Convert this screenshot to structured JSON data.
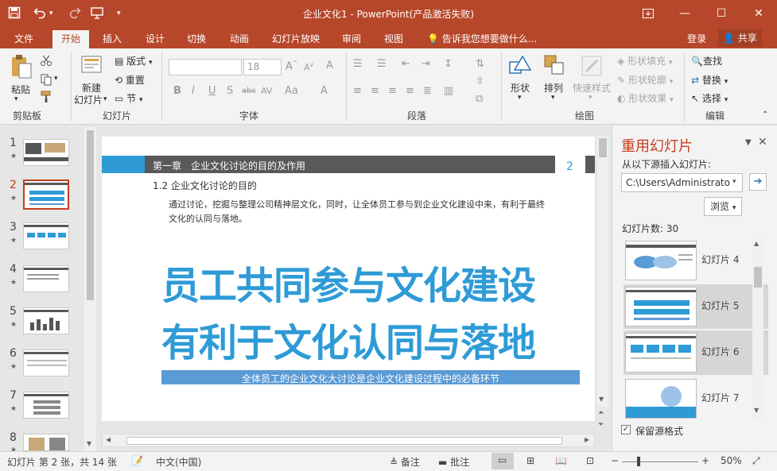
{
  "window": {
    "title": "企业文化1 - PowerPoint(产品激活失败)",
    "minimize_glyph": "—",
    "restore_glyph": "❐",
    "maximize_glyph": "☐",
    "close_glyph": "✕"
  },
  "qat": {
    "save_icon": "save-icon",
    "undo_icon": "undo-icon",
    "redo_icon": "redo-icon",
    "present_icon": "present-icon",
    "more": "▾"
  },
  "tabs": [
    "文件",
    "开始",
    "插入",
    "设计",
    "切换",
    "动画",
    "幻灯片放映",
    "审阅",
    "视图"
  ],
  "active_tab": "开始",
  "tell_me": "告诉我您想要做什么...",
  "account": {
    "login": "登录",
    "share": "共享"
  },
  "ribbon": {
    "clipboard": {
      "label": "剪贴板",
      "paste": "粘贴"
    },
    "slides": {
      "label": "幻灯片",
      "new_slide_line1": "新建",
      "new_slide_line2": "幻灯片",
      "layout": "版式",
      "reset": "重置",
      "section": "节"
    },
    "font": {
      "label": "字体",
      "font_name": "",
      "font_size": "18",
      "bold": "B",
      "italic": "I",
      "underline": "U",
      "strike": "S",
      "shadow": "abc",
      "spacing": "AV",
      "case": "Aa",
      "grow": "A",
      "shrink": "A",
      "clear": "A",
      "color": "A"
    },
    "paragraph": {
      "label": "段落"
    },
    "drawing": {
      "label": "绘图",
      "shapes": "形状",
      "arrange": "排列",
      "quick_styles": "快速样式",
      "fill": "形状填充",
      "outline": "形状轮廓",
      "effects": "形状效果"
    },
    "editing": {
      "label": "编辑",
      "find": "查找",
      "replace": "替换",
      "select": "选择"
    }
  },
  "thumbnails": [
    {
      "num": "1",
      "star": "★",
      "selected": false
    },
    {
      "num": "2",
      "star": "★",
      "selected": true
    },
    {
      "num": "3",
      "star": "★",
      "selected": false
    },
    {
      "num": "4",
      "star": "★",
      "selected": false
    },
    {
      "num": "5",
      "star": "★",
      "selected": false
    },
    {
      "num": "6",
      "star": "★",
      "selected": false
    },
    {
      "num": "7",
      "star": "★",
      "selected": false
    },
    {
      "num": "8",
      "star": "★",
      "selected": false
    }
  ],
  "slide": {
    "chapter": "第一章　企业文化讨论的目的及作用",
    "page_number": "2",
    "section": "1.2  企业文化讨论的目的",
    "body_line1": "通过讨论，挖掘与整理公司精神层文化，同时，让全体员工参与到企业文化建设中来，有利于最终",
    "body_line2": "文化的认同与落地。",
    "headline1": "员工共同参与文化建设",
    "headline2": "有利于文化认同与落地",
    "banner": "全体员工的企业文化大讨论是企业文化建设过程中的必备环节"
  },
  "task_pane": {
    "title": "重用幻灯片",
    "insert_from": "从以下源插入幻灯片:",
    "path": "C:\\Users\\Administrato",
    "browse": "浏览",
    "count": "幻灯片数: 30",
    "items": [
      "幻灯片 4",
      "幻灯片 5",
      "幻灯片 6",
      "幻灯片 7"
    ],
    "keep_format": "保留源格式"
  },
  "status": {
    "slide_info": "幻灯片 第 2 张，共 14 张",
    "language": "中文(中国)",
    "notes": "备注",
    "comments": "批注",
    "zoom": "50%"
  },
  "colors": {
    "accent": "#b7472a",
    "slide_blue": "#2e9bd6",
    "chapter_bar": "#595959",
    "selection": "#c43e1c"
  }
}
